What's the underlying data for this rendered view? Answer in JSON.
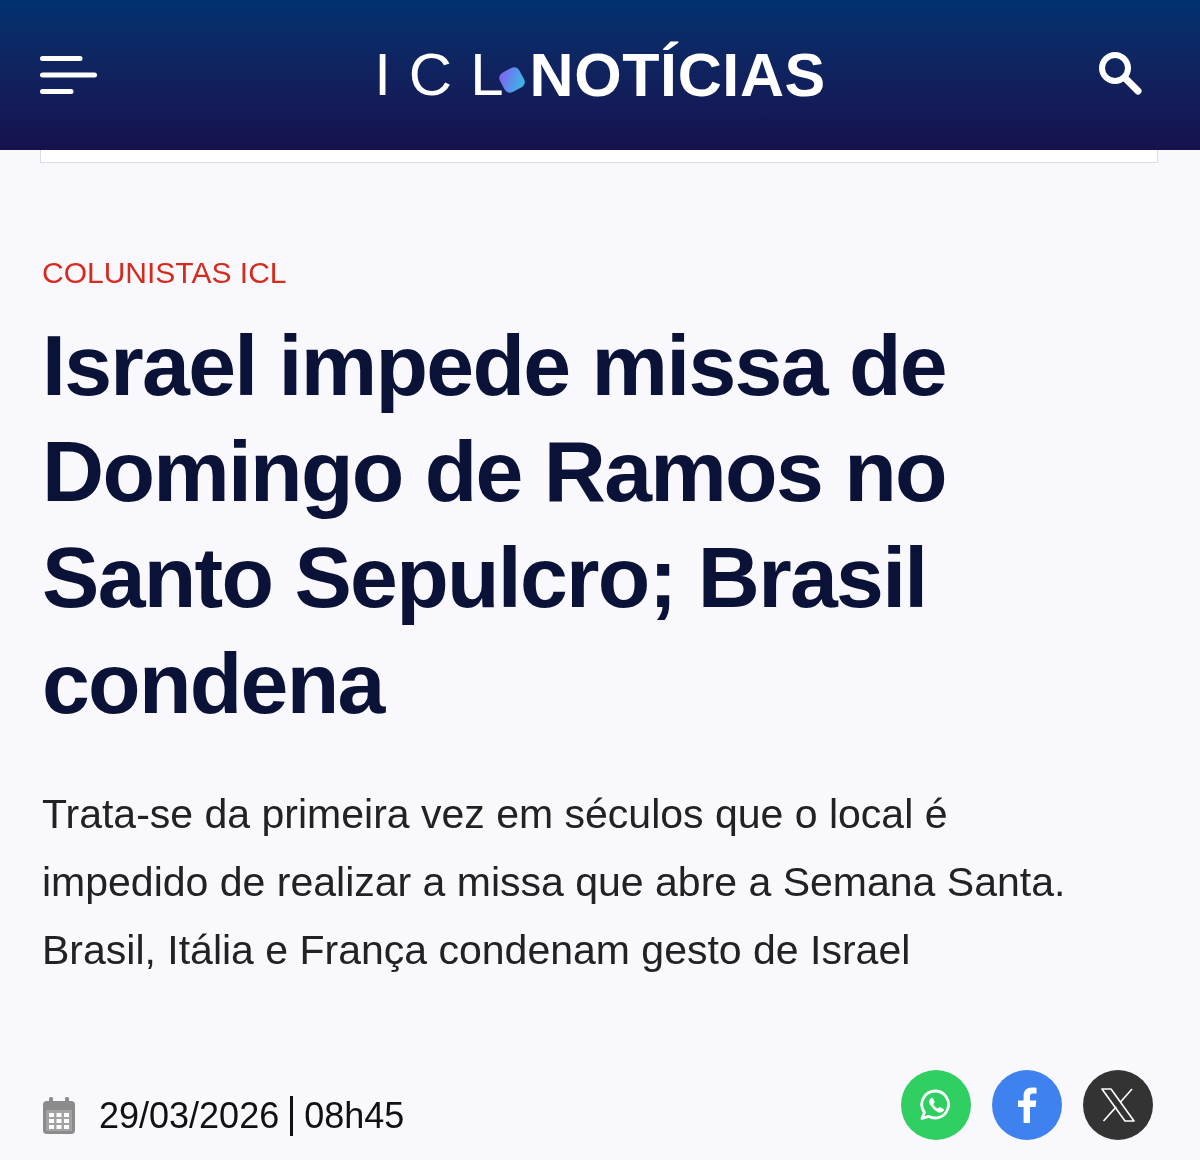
{
  "header": {
    "logo": {
      "prefix": "ICL",
      "name": "NOTÍCIAS"
    }
  },
  "article": {
    "category": "COLUNISTAS ICL",
    "headline": "Israel impede missa de Domingo de Ramos no Santo Sepulcro; Brasil condena",
    "summary": "Trata-se da primeira vez em séculos que o local é impedido de realizar a missa que abre a Semana Santa. Brasil, Itália e França condenam gesto de Israel",
    "date": "29/03/2026",
    "time": "08h45"
  },
  "share_buttons": [
    {
      "kind": "whatsapp"
    },
    {
      "kind": "facebook"
    },
    {
      "kind": "x"
    }
  ]
}
